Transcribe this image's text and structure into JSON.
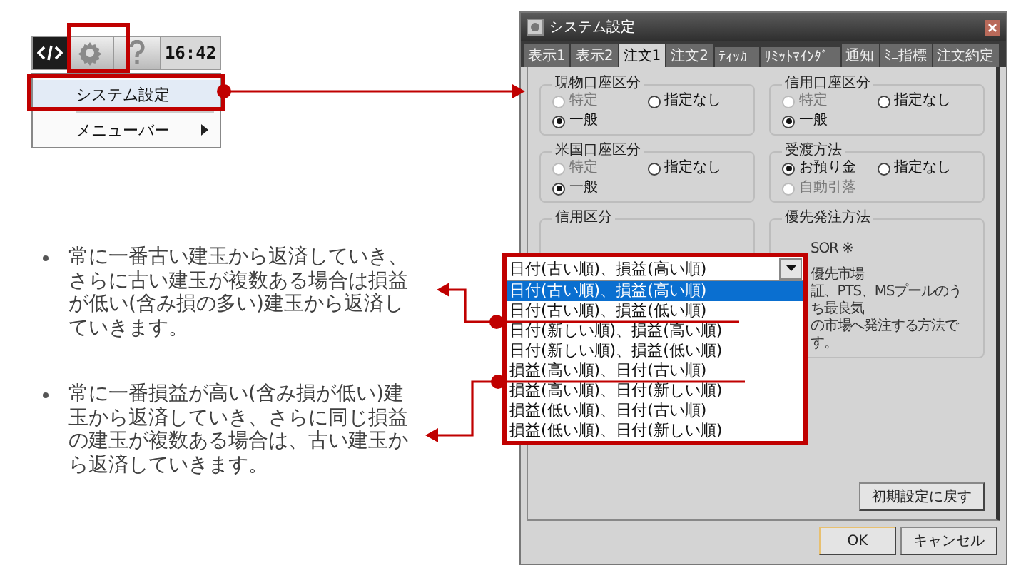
{
  "toolbar": {
    "time": "16:42"
  },
  "menu": {
    "items": [
      {
        "label": "システム設定",
        "highlighted": true,
        "submenu": false
      },
      {
        "label": "メニューバー",
        "highlighted": false,
        "submenu": true
      }
    ]
  },
  "notes": [
    "常に一番古い建玉から返済していき、さらに古い建玉が複数ある場合は損益が低い(含み損の多い)建玉から返済していきます。",
    "常に一番損益が高い(含み損が低い)建玉から返済していき、さらに同じ損益の建玉が複数ある場合は、古い建玉から返済していきます。"
  ],
  "dialog": {
    "title": "システム設定",
    "tabs": [
      {
        "label": "表示1",
        "selected": false
      },
      {
        "label": "表示2",
        "selected": false
      },
      {
        "label": "注文1",
        "selected": true
      },
      {
        "label": "注文2",
        "selected": false
      },
      {
        "label": "ﾃｨｯｶｰ",
        "selected": false
      },
      {
        "label": "ﾘﾐｯﾄﾏｲﾝﾀﾞｰ",
        "selected": false
      },
      {
        "label": "通知",
        "selected": false
      },
      {
        "label": "ﾐﾆ指標",
        "selected": false
      },
      {
        "label": "注文約定",
        "selected": false
      }
    ],
    "groups": [
      {
        "title": "現物口座区分",
        "options": [
          {
            "label": "特定",
            "selected": false,
            "disabled": true
          },
          {
            "label": "指定なし",
            "selected": false,
            "disabled": false
          },
          {
            "label": "一般",
            "selected": true,
            "disabled": false
          }
        ]
      },
      {
        "title": "信用口座区分",
        "options": [
          {
            "label": "特定",
            "selected": false,
            "disabled": true
          },
          {
            "label": "指定なし",
            "selected": false,
            "disabled": false
          },
          {
            "label": "一般",
            "selected": true,
            "disabled": false
          }
        ]
      },
      {
        "title": "米国口座区分",
        "options": [
          {
            "label": "特定",
            "selected": false,
            "disabled": true
          },
          {
            "label": "指定なし",
            "selected": false,
            "disabled": false
          },
          {
            "label": "一般",
            "selected": true,
            "disabled": false
          }
        ]
      },
      {
        "title": "受渡方法",
        "options": [
          {
            "label": "お預り金",
            "selected": true,
            "disabled": false
          },
          {
            "label": "指定なし",
            "selected": false,
            "disabled": false
          },
          {
            "label": "自動引落",
            "selected": false,
            "disabled": true
          }
        ]
      }
    ],
    "credit": {
      "title": "信用区分",
      "value": "日付(古い順)、損益(高い順)",
      "options": [
        {
          "label": "日付(古い順)、損益(高い順)",
          "selected": true
        },
        {
          "label": "日付(古い順)、損益(低い順)",
          "selected": false
        },
        {
          "label": "日付(新しい順)、損益(高い順)",
          "selected": false
        },
        {
          "label": "日付(新しい順)、損益(低い順)",
          "selected": false
        },
        {
          "label": "損益(高い順)、日付(古い順)",
          "selected": false
        },
        {
          "label": "損益(高い順)、日付(新しい順)",
          "selected": false
        },
        {
          "label": "損益(低い順)、日付(古い順)",
          "selected": false
        },
        {
          "label": "損益(低い順)、日付(新しい順)",
          "selected": false
        }
      ]
    },
    "priority": {
      "title": "優先発注方法",
      "lines": [
        "SOR ※",
        "優先市場",
        "証、PTS、MSプールのうち最良気",
        "の市場へ発注する方法です。"
      ]
    },
    "reset_button": "初期設定に戻す",
    "buttons": [
      {
        "label": "OK",
        "default": true
      },
      {
        "label": "キャンセル",
        "default": false
      }
    ]
  }
}
